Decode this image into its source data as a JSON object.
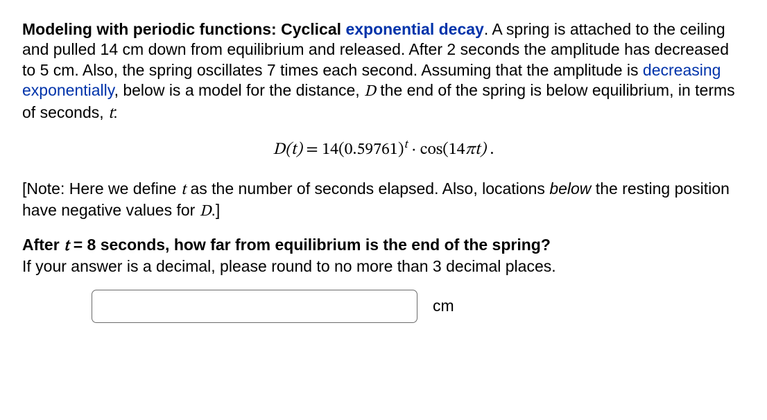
{
  "intro": {
    "lead_bold": "Modeling with periodic functions: Cyclical ",
    "lead_link": "exponential decay",
    "lead_tail": ". A spring is attached to the ceiling and pulled 14 cm down from equilibrium and released. After 2 seconds the amplitude has decreased to 5 cm. Also, the spring oscillates 7 times each second. Assuming that the amplitude is ",
    "decay_link": "decreasing exponentially",
    "tail2a": ", below is a model for the distance, ",
    "D": "D",
    "tail2b": " the end of the spring is below equilibrium, in terms of seconds, ",
    "t": "t",
    "tail2c": ":"
  },
  "equation": {
    "lhs": "D(t)",
    "eq": " = ",
    "coeff": "14(0.59761)",
    "exp": "t",
    "mid": " · cos(14",
    "pi": "π",
    "arg_tail": "t)",
    "end": " ."
  },
  "note": {
    "open": "[Note: Here we define ",
    "t": "t",
    "mid": " as the number of seconds elapsed. Also, locations ",
    "below": "below",
    "tail": " the resting position have negative values for ",
    "D": "D",
    "close": ".]"
  },
  "question": {
    "b1": "After ",
    "t": "t",
    "eq": " = 8",
    "b2": " seconds, how far from equilibrium is the end of the spring?",
    "line2": "If your answer is a decimal, please round to no more than 3 decimal places."
  },
  "answer": {
    "value": "",
    "unit": "cm"
  }
}
